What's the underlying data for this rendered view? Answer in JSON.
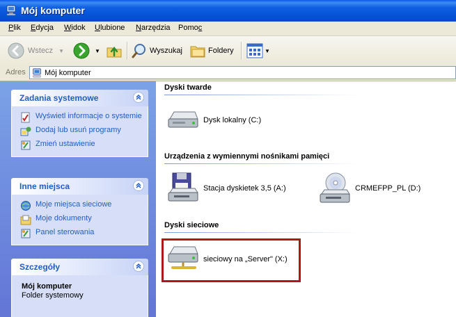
{
  "window": {
    "title": "Mój komputer"
  },
  "menu": {
    "items": [
      "Plik",
      "Edycja",
      "Widok",
      "Ulubione",
      "Narzędzia",
      "Pomoc"
    ],
    "underline": [
      "P",
      "E",
      "W",
      "U",
      "N",
      "c"
    ]
  },
  "toolbar": {
    "back": "Wstecz",
    "search": "Wyszukaj",
    "folders": "Foldery"
  },
  "address": {
    "label": "Adres",
    "value": "Mój komputer"
  },
  "left": {
    "system_tasks": {
      "title": "Zadania systemowe",
      "items": [
        "Wyświetl informacje o systemie",
        "Dodaj lub usuń programy",
        "Zmień ustawienie"
      ]
    },
    "other_places": {
      "title": "Inne miejsca",
      "items": [
        "Moje miejsca sieciowe",
        "Moje dokumenty",
        "Panel sterowania"
      ]
    },
    "details": {
      "title": "Szczegóły",
      "name": "Mój komputer",
      "type": "Folder systemowy"
    }
  },
  "content": {
    "hard_drives": {
      "title": "Dyski twarde",
      "items": [
        "Dysk lokalny (C:)"
      ]
    },
    "removable": {
      "title": "Urządzenia z wymiennymi nośnikami pamięci",
      "items": [
        "Stacja dyskietek 3,5 (A:)",
        "CRMEFPP_PL (D:)"
      ]
    },
    "network": {
      "title": "Dyski sieciowe",
      "items": [
        "sieciowy na „Server\" (X:)"
      ]
    }
  },
  "colors": {
    "highlight": "#b01717",
    "titlebar": "#0653d8",
    "link": "#215dc6"
  }
}
